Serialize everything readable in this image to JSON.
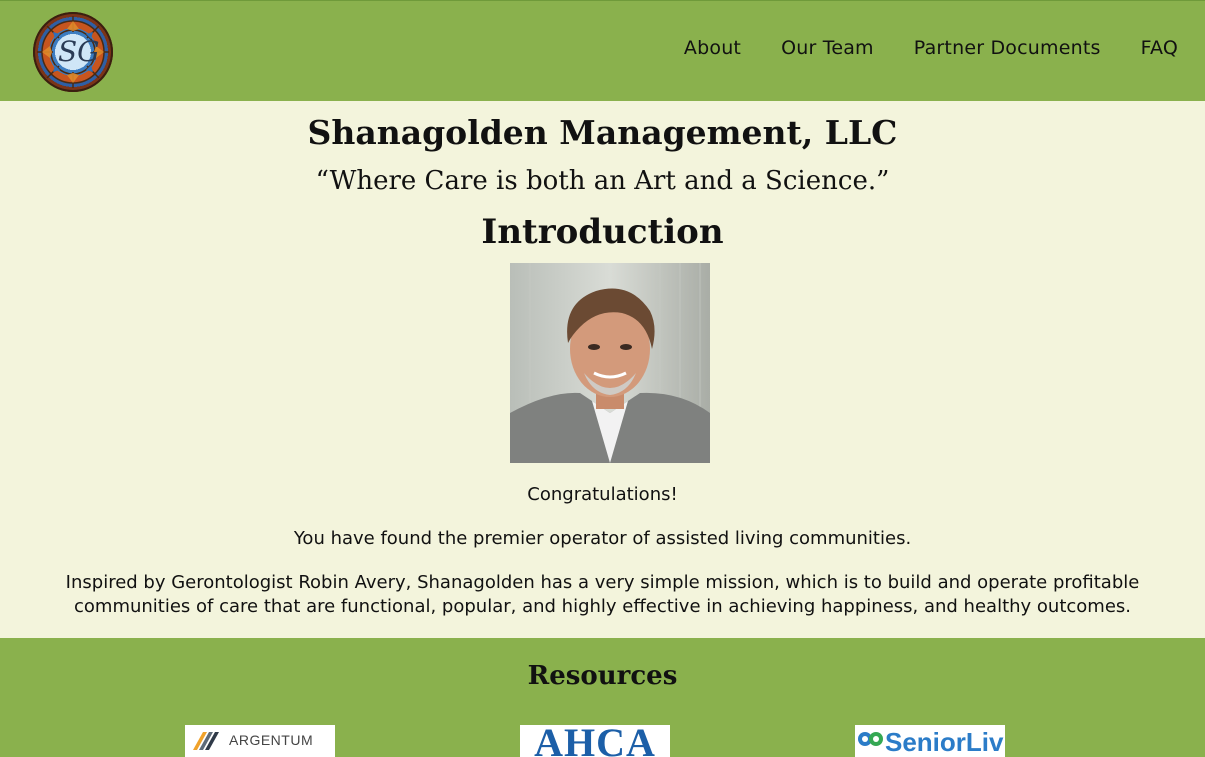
{
  "header": {
    "logo_alt": "SG",
    "nav": {
      "about": "About",
      "our_team": "Our Team",
      "partner_documents": "Partner Documents",
      "faq": "FAQ"
    }
  },
  "main": {
    "company_name": "Shanagolden Management, LLC",
    "tagline": "“Where Care is both an Art and a Science.”",
    "section_title": "Introduction",
    "paragraphs": {
      "congrats": "Congratulations!",
      "found": "You have found the premier operator of assisted living communities.",
      "mission": "Inspired by Gerontologist Robin Avery, Shanagolden has a very simple mission, which is to build and operate profitable communities of care that are functional, popular, and highly effective in achieving happiness, and healthy outcomes."
    }
  },
  "footer": {
    "title": "Resources",
    "logos": {
      "argentum": "ARGENTUM",
      "ahca": "AHCA",
      "senior_living": "SeniorLiving"
    }
  },
  "colors": {
    "header_bg": "#8ab14d",
    "page_bg": "#f3f4dc"
  }
}
